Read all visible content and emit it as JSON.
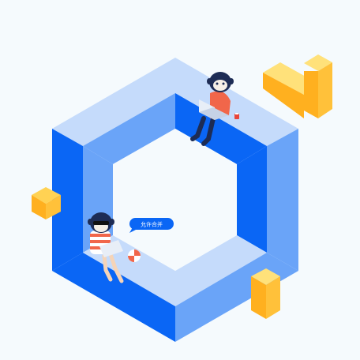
{
  "bubble": {
    "label": "允许合并"
  },
  "icons": {
    "frame": "isometric-hexagon-frame-icon",
    "person_top": "monkey-with-laptop-icon",
    "person_bottom": "monkey-with-sunglasses-icon",
    "ball": "beach-ball-icon",
    "mug": "mug-icon",
    "block_left": "yellow-cube-icon",
    "block_right_top": "yellow-l-bracket-icon",
    "block_right_bottom": "yellow-bar-icon"
  },
  "colors": {
    "background": "#f5fafd",
    "frame_dark": "#0a66f5",
    "frame_mid": "#6aa4f8",
    "frame_light": "#c5dbfb",
    "accent_yellow": "#ffd253",
    "accent_orange": "#ffb01f",
    "shirt": "#f1664a",
    "bubble": "#0a66f5"
  }
}
